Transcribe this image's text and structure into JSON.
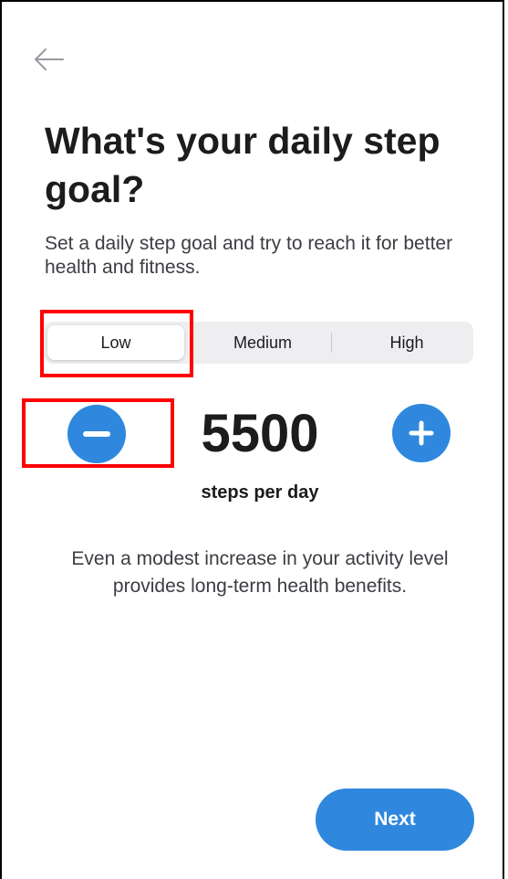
{
  "header": {
    "back_icon": "arrow-left-icon"
  },
  "title": "What's your daily step goal?",
  "subtitle": "Set a daily step goal and try to reach it for better health and fitness.",
  "goal_levels": {
    "options": [
      "Low",
      "Medium",
      "High"
    ],
    "selected": "Low"
  },
  "stepper": {
    "value": "5500",
    "unit_label": "steps per day",
    "decrement_icon": "minus-icon",
    "increment_icon": "plus-icon"
  },
  "info_text": "Even a modest increase in your activity level provides long-term health benefits.",
  "footer": {
    "next_label": "Next"
  },
  "colors": {
    "accent": "#2f88de",
    "highlight": "#ff0000",
    "segment_bg": "#eeeef0"
  }
}
